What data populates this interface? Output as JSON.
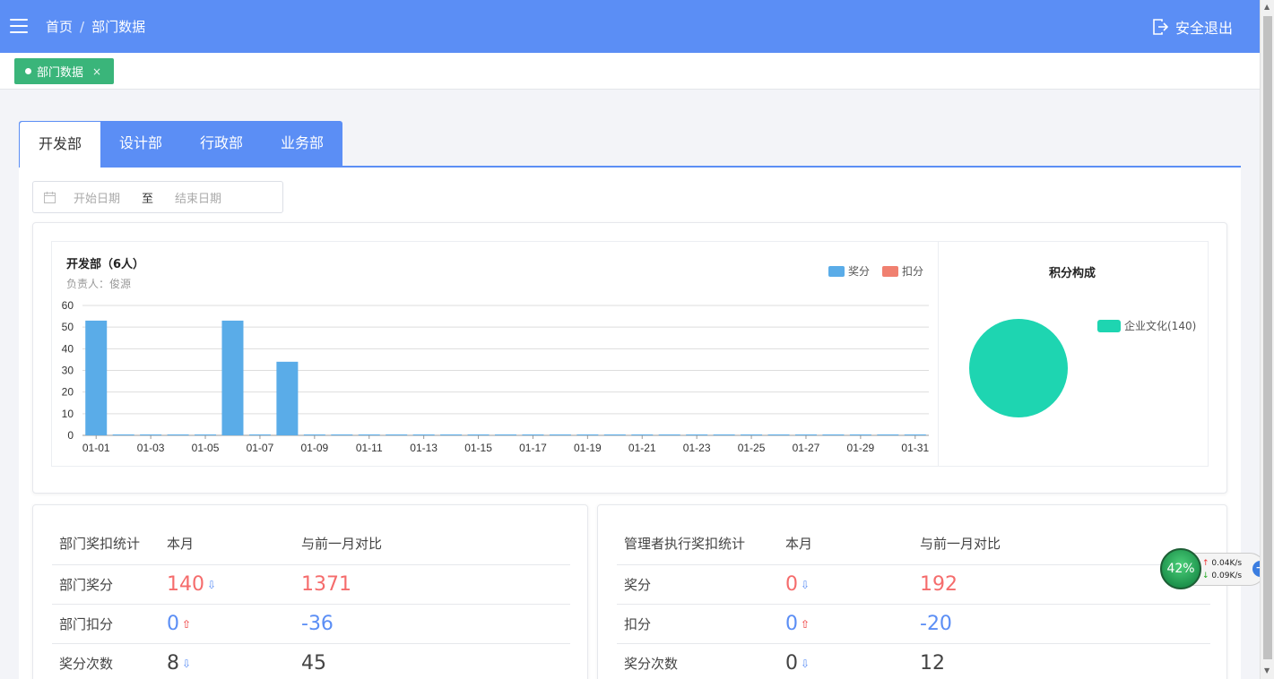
{
  "header": {
    "breadcrumb": [
      "首页",
      "部门数据"
    ],
    "breadcrumb_sep": "/",
    "logout_label": "安全退出"
  },
  "tags": [
    {
      "label": "部门数据",
      "close": "×"
    }
  ],
  "tabs": [
    "开发部",
    "设计部",
    "行政部",
    "业务部"
  ],
  "date_range": {
    "start_placeholder": "开始日期",
    "separator": "至",
    "end_placeholder": "结束日期"
  },
  "colors": {
    "accent": "#5b8ef5",
    "award": "#5aace8",
    "deduct": "#f08070",
    "pie": "#1ed5b1",
    "tag": "#3ab57a"
  },
  "chart_data": [
    {
      "type": "bar",
      "title": "开发部（6人）",
      "subtitle": "负责人：俊源",
      "legend": [
        "奖分",
        "扣分"
      ],
      "legend_position": "top-right",
      "categories": [
        "01-01",
        "01-02",
        "01-03",
        "01-04",
        "01-05",
        "01-06",
        "01-07",
        "01-08",
        "01-09",
        "01-10",
        "01-11",
        "01-12",
        "01-13",
        "01-14",
        "01-15",
        "01-16",
        "01-17",
        "01-18",
        "01-19",
        "01-20",
        "01-21",
        "01-22",
        "01-23",
        "01-24",
        "01-25",
        "01-26",
        "01-27",
        "01-28",
        "01-29",
        "01-30",
        "01-31"
      ],
      "tick_labels": [
        "01-01",
        "01-03",
        "01-05",
        "01-07",
        "01-09",
        "01-11",
        "01-13",
        "01-15",
        "01-17",
        "01-19",
        "01-21",
        "01-23",
        "01-25",
        "01-27",
        "01-29",
        "01-31"
      ],
      "series": [
        {
          "name": "奖分",
          "values": [
            53,
            0,
            0,
            0,
            0,
            53,
            0,
            34,
            0,
            0,
            0,
            0,
            0,
            0,
            0,
            0,
            0,
            0,
            0,
            0,
            0,
            0,
            0,
            0,
            0,
            0,
            0,
            0,
            0,
            0,
            0
          ]
        },
        {
          "name": "扣分",
          "values": [
            0,
            0,
            0,
            0,
            0,
            0,
            0,
            0,
            0,
            0,
            0,
            0,
            0,
            0,
            0,
            0,
            0,
            0,
            0,
            0,
            0,
            0,
            0,
            0,
            0,
            0,
            0,
            0,
            0,
            0,
            0
          ]
        }
      ],
      "y_ticks": [
        0,
        10,
        20,
        30,
        40,
        50,
        60
      ],
      "ylim": [
        0,
        60
      ],
      "grid": true
    },
    {
      "type": "pie",
      "title": "积分构成",
      "slices": [
        {
          "name": "企业文化",
          "value": 140,
          "label": "企业文化(140)"
        }
      ]
    }
  ],
  "stats_left": {
    "headers": [
      "部门奖扣统计",
      "本月",
      "与前一月对比"
    ],
    "rows": [
      {
        "label": "部门奖分",
        "value": "140",
        "trend": "down",
        "compare": "1371"
      },
      {
        "label": "部门扣分",
        "value": "0",
        "trend": "up",
        "compare": "-36"
      },
      {
        "label": "奖分次数",
        "value": "8",
        "trend": "down",
        "compare": "45"
      }
    ]
  },
  "stats_right": {
    "headers": [
      "管理者执行奖扣统计",
      "本月",
      "与前一月对比"
    ],
    "rows": [
      {
        "label": "奖分",
        "value": "0",
        "trend": "down",
        "compare": "192"
      },
      {
        "label": "扣分",
        "value": "0",
        "trend": "up",
        "compare": "-20"
      },
      {
        "label": "奖分次数",
        "value": "0",
        "trend": "down",
        "compare": "12"
      }
    ]
  },
  "net_widget": {
    "percent": "42%",
    "up": "0.04K/s",
    "down": "0.09K/s"
  }
}
